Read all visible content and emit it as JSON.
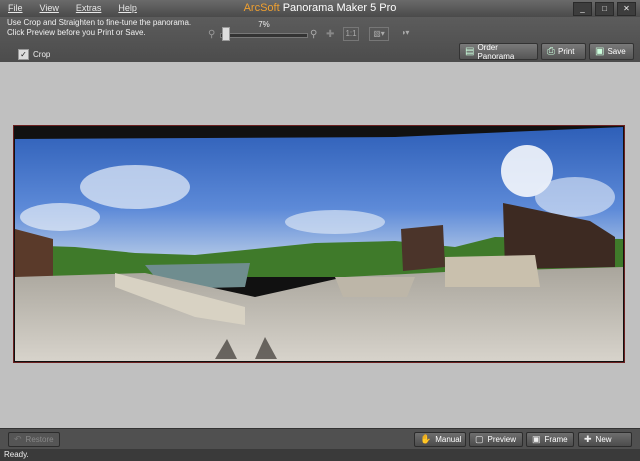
{
  "menu": [
    "File",
    "View",
    "Extras",
    "Help"
  ],
  "title": {
    "brand": "ArcSoft",
    "rest": " Panorama Maker 5 Pro"
  },
  "window_buttons": [
    "_",
    "□",
    "✕"
  ],
  "hint": {
    "line1": "Use Crop and Straighten to fine-tune the panorama.",
    "line2": "Click Preview before you Print or Save."
  },
  "crop": {
    "label": "Crop",
    "checked": "✓"
  },
  "zoom": {
    "percent": "7%"
  },
  "toolbar": {
    "order": "Order Panorama",
    "print": "Print",
    "save": "Save"
  },
  "bottom": {
    "restore": "Restore",
    "manual": "Manual",
    "preview": "Preview",
    "frame": "Frame",
    "new": "New"
  },
  "status": "Ready."
}
